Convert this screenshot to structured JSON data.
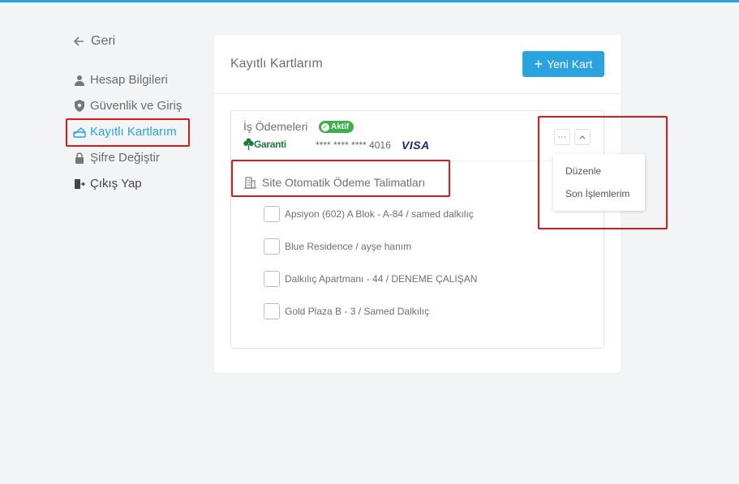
{
  "nav": {
    "back_label": "Geri",
    "items": [
      {
        "label": "Hesap Bilgileri",
        "icon": "user-icon"
      },
      {
        "label": "Güvenlik ve Giriş",
        "icon": "shield-icon"
      },
      {
        "label": "Kayıtlı Kartlarım",
        "icon": "credit-card-icon",
        "active": true
      },
      {
        "label": "Şifre Değiştir",
        "icon": "lock-icon"
      },
      {
        "label": "Çıkış Yap",
        "icon": "logout-icon"
      }
    ]
  },
  "panel": {
    "title": "Kayıtlı Kartlarım",
    "new_card_button": "Yeni Kart",
    "card": {
      "name": "İş Ödemeleri",
      "status": "Aktif",
      "bank": "Garanti",
      "number": "**** **** **** 4016",
      "network": "VISA"
    },
    "section_title": "Site Otomatik Ödeme Talimatları",
    "items": [
      "Apsiyon (602) A Blok - A-84 / samed dalkılıç",
      "Blue Residence / ayşe hanım",
      "Dalkılıç Apartmanı - 44 / DENEME ÇALIŞAN",
      "Gold Plaza B - 3 / Samed Dalkılıç"
    ]
  },
  "dropdown": {
    "items": [
      "Düzenle",
      "Son İşlemlerim"
    ]
  },
  "colors": {
    "accent": "#2aa3df",
    "active_badge": "#3cb04a",
    "highlight": "#e01818"
  }
}
